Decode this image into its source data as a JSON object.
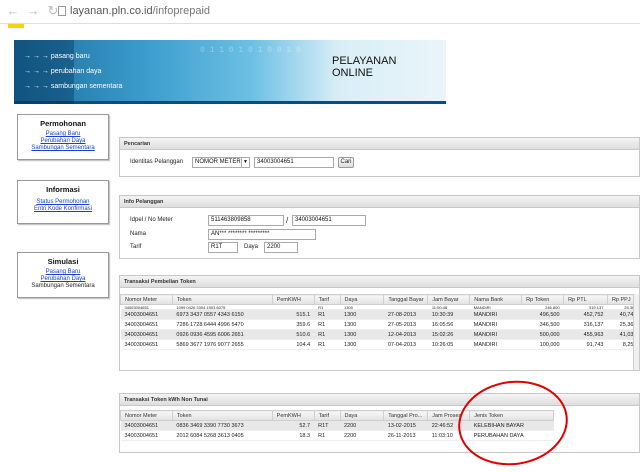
{
  "browser": {
    "back_glyph": "←",
    "forward_glyph": "→",
    "reload_glyph": "↻",
    "url_host": "layanan.pln.co.id",
    "url_path": "/infoprepaid"
  },
  "banner": {
    "menu": [
      "pasang baru",
      "perubahan daya",
      "sambungan sementara"
    ],
    "arrows": "→ → →",
    "title_line1": "PELAYANAN",
    "title_line2": "ONLINE",
    "binary": "0 1 1 0  1 0 1 0  0 1 0"
  },
  "sidebar": {
    "permohonan": {
      "title": "Permohonan",
      "links": [
        "Pasang Baru",
        "Perubahan Daya",
        "Sambungan Sementara"
      ]
    },
    "informasi": {
      "title": "Informasi",
      "links": [
        "Status Permohonan",
        "Entri Kode Konfirmasi"
      ]
    },
    "simulasi": {
      "title": "Simulasi",
      "links": [
        "Pasang Baru",
        "Perubahan Daya"
      ],
      "plain": "Sambungan Sementara"
    }
  },
  "pencarian": {
    "title": "Pencarian",
    "label": "Identitas Pelanggan",
    "select_value": "NOMOR METER",
    "input_value": "34003004651",
    "button": "Cari"
  },
  "info": {
    "title": "Info Pelanggan",
    "idpel_label": "Idpel / No Meter",
    "idpel": "511463809858",
    "slash": "/",
    "nometer": "34003004651",
    "nama_label": "Nama",
    "nama": "AN*** ******** *********",
    "tarif_label": "Tarif",
    "tarif": "R1T",
    "daya_label": "Daya",
    "daya": "2200"
  },
  "transaksi": {
    "title": "Transaksi Pembelian Token",
    "headers": [
      "Nomor Meter",
      "Token",
      "PemKWH",
      "Tarif",
      "Daya",
      "Tanggal Bayar",
      "Jam Bayar",
      "Nama Bank",
      "Rp Token",
      "Rp PTL",
      "Rp PPJ"
    ],
    "partial_row": [
      "34003004651",
      "1099 0426 3304 1903 6075",
      "",
      "R1",
      "1300",
      "",
      "11:00:48",
      "MANDIRI",
      "246,800",
      "319,137",
      "25,363"
    ],
    "rows": [
      [
        "34003004651",
        "6973 3437 0557 4343 6150",
        "515.1",
        "R1",
        "1300",
        "27-08-2013",
        "10:30:39",
        "MANDIRI",
        "496,500",
        "452,752",
        "40,748"
      ],
      [
        "34003004651",
        "7286 1728 6444 4996 5470",
        "359.6",
        "R1",
        "1300",
        "27-05-2013",
        "16:05:56",
        "MANDIRI",
        "346,500",
        "316,137",
        "25,363"
      ],
      [
        "34003004651",
        "0926 0936 4595 6006 2651",
        "510.6",
        "R1",
        "1300",
        "12-04-2013",
        "15:02:26",
        "MANDIRI",
        "500,000",
        "455,963",
        "41,037"
      ],
      [
        "34003004651",
        "5869 3677 1976 9077 2655",
        "104.4",
        "R1",
        "1300",
        "07-04-2013",
        "10:26:05",
        "MANDIRI",
        "100,000",
        "91,743",
        "8,257"
      ]
    ]
  },
  "nontunai": {
    "title": "Transaksi Token kWh Non Tunai",
    "headers": [
      "Nomor Meter",
      "Token",
      "PemKWH",
      "Tarif",
      "Daya",
      "Tanggal Pro...",
      "Jam Proses",
      "Jenis Token"
    ],
    "rows": [
      [
        "34003004651",
        "0836 3469 3390 7730 3673",
        "52.7",
        "R1T",
        "2200",
        "13-02-2015",
        "22:46:52",
        "KELEBIHAN BAYAR"
      ],
      [
        "34003004651",
        "2012 6084 5268 3613 0405",
        "18.3",
        "R1",
        "2200",
        "26-11-2013",
        "11:03:10",
        "PERUBAHAN DAYA"
      ]
    ]
  },
  "annotation": {
    "circle_color": "#e00000"
  }
}
